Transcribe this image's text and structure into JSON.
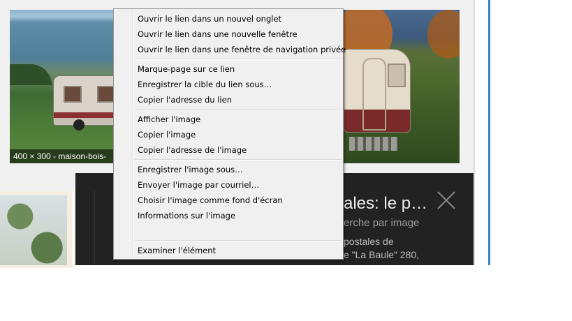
{
  "results": {
    "left_caption": "400 × 300 - maison-bois-"
  },
  "detail": {
    "title": "ales: le p…",
    "subtitle": "erche par image",
    "desc_line1": "postales de",
    "desc_line2": "e \"La Baule\" 280,",
    "close_icon": "close-icon"
  },
  "context_menu": {
    "items": [
      "Ouvrir le lien dans un nouvel onglet",
      "Ouvrir le lien dans une nouvelle fenêtre",
      "Ouvrir le lien dans une fenêtre de navigation privée",
      "Marque-page sur ce lien",
      "Enregistrer la cible du lien sous…",
      "Copier l'adresse du lien",
      "Afficher l'image",
      "Copier l'image",
      "Copier l'adresse de l'image",
      "Enregistrer l'image sous…",
      "Envoyer l'image par courriel…",
      "Choisir l'image comme fond d'écran",
      "Informations sur l'image",
      "Examiner l'élément"
    ]
  },
  "colors": {
    "menu_background": "#f0f0f0",
    "dark_panel": "#222222",
    "window_edge": "#3b7fd0"
  }
}
